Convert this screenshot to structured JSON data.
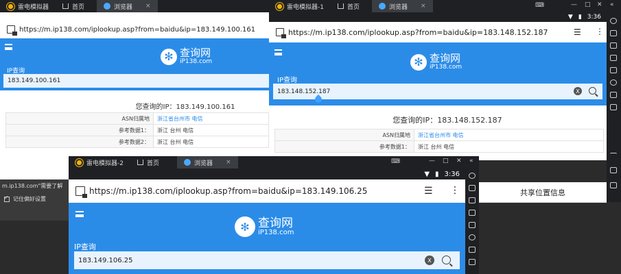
{
  "common": {
    "emu_tab": "雷电模拟器",
    "home_tab": "首页",
    "browser_tab": "浏览器",
    "close_glyph": "×",
    "brand_title": "查询网",
    "brand_sub": "iP138.com",
    "ip_label": "IP查询",
    "result_prefix": "您查询的IP：",
    "asn_key": "ASN归属地",
    "ref1_key": "参考数据1：",
    "ref2_key": "参考数据2：",
    "clear_glyph": "X",
    "time": "3:36"
  },
  "win1": {
    "url": "https://m.ip138.com/iplookup.asp?from=baidu&ip=183.149.100.161",
    "ip_value": "183.149.100.161",
    "result_ip": "183.149.100.161",
    "asn_val": "浙江省台州市 电信",
    "ref1_val": "浙江 台州 电信",
    "ref2_val": "浙江 台州 电信"
  },
  "win2": {
    "emu_tab": "雷电模拟器-1",
    "url": "https://m.ip138.com/iplookup.asp?from=baidu&ip=183.148.152.187",
    "ip_value": "183.148.152.187",
    "result_ip": "183.148.152.187",
    "asn_val": "浙江省台州市 电信",
    "ref1_val": "浙江 台州 电信",
    "share": "共享位置信息"
  },
  "win3": {
    "emu_tab": "雷电模拟器-2",
    "url": "https://m.ip138.com/iplookup.asp?from=baidu&ip=183.149.106.25",
    "ip_value": "183.149.106.25"
  },
  "notification": {
    "text": "m.ip138.com\"需要了解",
    "checkbox_label": "记住偏好设置"
  },
  "colors": {
    "accent": "#2b8ce8",
    "titlebar": "#1f2023"
  }
}
